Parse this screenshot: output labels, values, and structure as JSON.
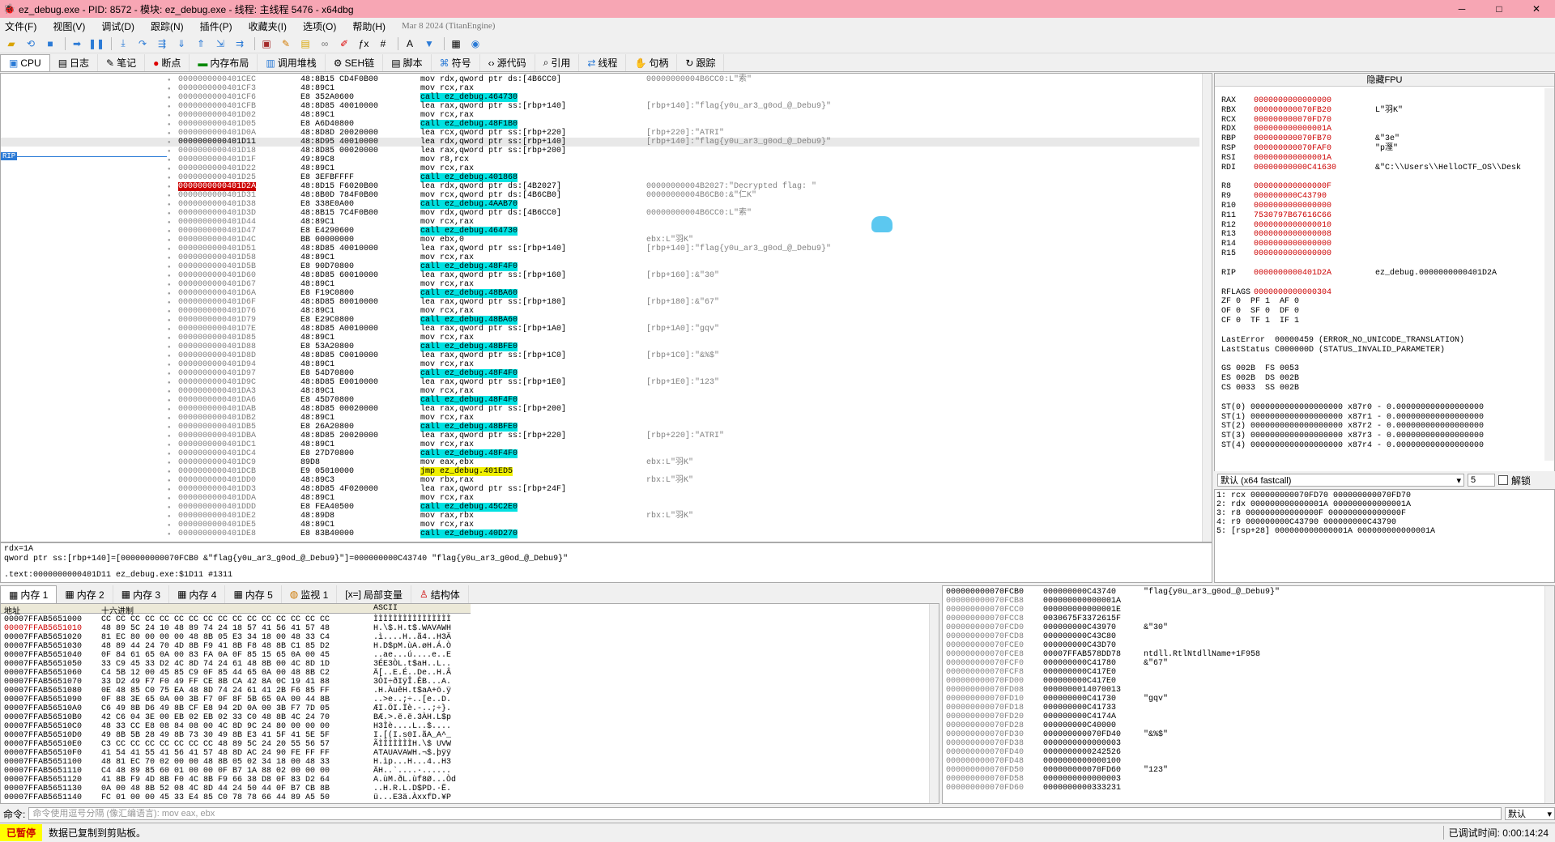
{
  "window": {
    "title": "ez_debug.exe - PID: 8572 - 模块: ez_debug.exe - 线程: 主线程 5476 - x64dbg",
    "minimize": "─",
    "maximize": "□",
    "close": "✕"
  },
  "menu": [
    "文件(F)",
    "视图(V)",
    "调试(D)",
    "跟踪(N)",
    "插件(P)",
    "收藏夹(I)",
    "选项(O)",
    "帮助(H)"
  ],
  "menu_date": "Mar 8 2024 (TitanEngine)",
  "tabs": [
    "CPU",
    "日志",
    "笔记",
    "断点",
    "内存布局",
    "调用堆栈",
    "SEH链",
    "脚本",
    "符号",
    "源代码",
    "引用",
    "线程",
    "句柄",
    "跟踪"
  ],
  "disasm": [
    {
      "addr": "0000000000401CEC",
      "bytes": "48:8B15 CD4F0B00",
      "asm": "mov rdx,qword ptr ds:[4B6CC0]",
      "cmt": "00000000004B6CC0:L\"索\""
    },
    {
      "addr": "0000000000401CF3",
      "bytes": "48:89C1",
      "asm": "mov rcx,rax",
      "cmt": ""
    },
    {
      "addr": "0000000000401CF6",
      "bytes": "E8 352A0600",
      "asm": "call ez_debug.464730",
      "cmt": ""
    },
    {
      "addr": "0000000000401CFB",
      "bytes": "48:8D85 40010000",
      "asm": "lea rax,qword ptr ss:[rbp+140]",
      "cmt": "[rbp+140]:\"flag{y0u_ar3_g0od_@_Debu9}\""
    },
    {
      "addr": "0000000000401D02",
      "bytes": "48:89C1",
      "asm": "mov rcx,rax",
      "cmt": ""
    },
    {
      "addr": "0000000000401D05",
      "bytes": "E8 A6D40800",
      "asm": "call ez_debug.48F1B0",
      "cmt": ""
    },
    {
      "addr": "0000000000401D0A",
      "bytes": "48:8D8D 20020000",
      "asm": "lea rcx,qword ptr ss:[rbp+220]",
      "cmt": "[rbp+220]:\"ATRI\""
    },
    {
      "addr": "0000000000401D11",
      "bytes": "48:8D95 40010000",
      "asm": "lea rdx,qword ptr ss:[rbp+140]",
      "cmt": "[rbp+140]:\"flag{y0u_ar3_g0od_@_Debu9}\""
    },
    {
      "addr": "0000000000401D18",
      "bytes": "48:8D85 00020000",
      "asm": "lea rax,qword ptr ss:[rbp+200]",
      "cmt": ""
    },
    {
      "addr": "0000000000401D1F",
      "bytes": "49:89C8",
      "asm": "mov r8,rcx",
      "cmt": ""
    },
    {
      "addr": "0000000000401D22",
      "bytes": "48:89C1",
      "asm": "mov rcx,rax",
      "cmt": ""
    },
    {
      "addr": "0000000000401D25",
      "bytes": "E8 3EFBFFFF",
      "asm": "call ez_debug.401868",
      "cmt": ""
    },
    {
      "addr": "0000000000401D2A",
      "bytes": "48:8D15 F6020B00",
      "asm": "lea rdx,qword ptr ds:[4B2027]",
      "cmt": "00000000004B2027:\"Decrypted flag: \""
    },
    {
      "addr": "0000000000401D31",
      "bytes": "48:8B0D 784F0B00",
      "asm": "mov rcx,qword ptr ds:[4B6CB0]",
      "cmt": "00000000004B6CB0:&\"仁K\""
    },
    {
      "addr": "0000000000401D38",
      "bytes": "E8 338E0A00",
      "asm": "call ez_debug.4AAB70",
      "cmt": ""
    },
    {
      "addr": "0000000000401D3D",
      "bytes": "48:8B15 7C4F0B00",
      "asm": "mov rdx,qword ptr ds:[4B6CC0]",
      "cmt": "00000000004B6CC0:L\"索\""
    },
    {
      "addr": "0000000000401D44",
      "bytes": "48:89C1",
      "asm": "mov rcx,rax",
      "cmt": ""
    },
    {
      "addr": "0000000000401D47",
      "bytes": "E8 E4290600",
      "asm": "call ez_debug.464730",
      "cmt": ""
    },
    {
      "addr": "0000000000401D4C",
      "bytes": "BB 00000000",
      "asm": "mov ebx,0",
      "cmt": "ebx:L\"羽K\""
    },
    {
      "addr": "0000000000401D51",
      "bytes": "48:8D85 40010000",
      "asm": "lea rax,qword ptr ss:[rbp+140]",
      "cmt": "[rbp+140]:\"flag{y0u_ar3_g0od_@_Debu9}\""
    },
    {
      "addr": "0000000000401D58",
      "bytes": "48:89C1",
      "asm": "mov rcx,rax",
      "cmt": ""
    },
    {
      "addr": "0000000000401D5B",
      "bytes": "E8 90D70800",
      "asm": "call ez_debug.48F4F0",
      "cmt": ""
    },
    {
      "addr": "0000000000401D60",
      "bytes": "48:8D85 60010000",
      "asm": "lea rax,qword ptr ss:[rbp+160]",
      "cmt": "[rbp+160]:&\"30\""
    },
    {
      "addr": "0000000000401D67",
      "bytes": "48:89C1",
      "asm": "mov rcx,rax",
      "cmt": ""
    },
    {
      "addr": "0000000000401D6A",
      "bytes": "E8 F19C0800",
      "asm": "call ez_debug.48BA60",
      "cmt": ""
    },
    {
      "addr": "0000000000401D6F",
      "bytes": "48:8D85 80010000",
      "asm": "lea rax,qword ptr ss:[rbp+180]",
      "cmt": "[rbp+180]:&\"67\""
    },
    {
      "addr": "0000000000401D76",
      "bytes": "48:89C1",
      "asm": "mov rcx,rax",
      "cmt": ""
    },
    {
      "addr": "0000000000401D79",
      "bytes": "E8 E29C0800",
      "asm": "call ez_debug.48BA60",
      "cmt": ""
    },
    {
      "addr": "0000000000401D7E",
      "bytes": "48:8D85 A0010000",
      "asm": "lea rax,qword ptr ss:[rbp+1A0]",
      "cmt": "[rbp+1A0]:\"gqv\""
    },
    {
      "addr": "0000000000401D85",
      "bytes": "48:89C1",
      "asm": "mov rcx,rax",
      "cmt": ""
    },
    {
      "addr": "0000000000401D88",
      "bytes": "E8 53A20800",
      "asm": "call ez_debug.48BFE0",
      "cmt": ""
    },
    {
      "addr": "0000000000401D8D",
      "bytes": "48:8D85 C0010000",
      "asm": "lea rax,qword ptr ss:[rbp+1C0]",
      "cmt": "[rbp+1C0]:\"&%$\""
    },
    {
      "addr": "0000000000401D94",
      "bytes": "48:89C1",
      "asm": "mov rcx,rax",
      "cmt": ""
    },
    {
      "addr": "0000000000401D97",
      "bytes": "E8 54D70800",
      "asm": "call ez_debug.48F4F0",
      "cmt": ""
    },
    {
      "addr": "0000000000401D9C",
      "bytes": "48:8D85 E0010000",
      "asm": "lea rax,qword ptr ss:[rbp+1E0]",
      "cmt": "[rbp+1E0]:\"123\""
    },
    {
      "addr": "0000000000401DA3",
      "bytes": "48:89C1",
      "asm": "mov rcx,rax",
      "cmt": ""
    },
    {
      "addr": "0000000000401DA6",
      "bytes": "E8 45D70800",
      "asm": "call ez_debug.48F4F0",
      "cmt": ""
    },
    {
      "addr": "0000000000401DAB",
      "bytes": "48:8D85 00020000",
      "asm": "lea rax,qword ptr ss:[rbp+200]",
      "cmt": ""
    },
    {
      "addr": "0000000000401DB2",
      "bytes": "48:89C1",
      "asm": "mov rcx,rax",
      "cmt": ""
    },
    {
      "addr": "0000000000401DB5",
      "bytes": "E8 26A20800",
      "asm": "call ez_debug.48BFE0",
      "cmt": ""
    },
    {
      "addr": "0000000000401DBA",
      "bytes": "48:8D85 20020000",
      "asm": "lea rax,qword ptr ss:[rbp+220]",
      "cmt": "[rbp+220]:\"ATRI\""
    },
    {
      "addr": "0000000000401DC1",
      "bytes": "48:89C1",
      "asm": "mov rcx,rax",
      "cmt": ""
    },
    {
      "addr": "0000000000401DC4",
      "bytes": "E8 27D70800",
      "asm": "call ez_debug.48F4F0",
      "cmt": ""
    },
    {
      "addr": "0000000000401DC9",
      "bytes": "89D8",
      "asm": "mov eax,ebx",
      "cmt": "ebx:L\"羽K\""
    },
    {
      "addr": "0000000000401DCB",
      "bytes": "E9 05010000",
      "asm": "jmp ez_debug.401ED5",
      "cmt": ""
    },
    {
      "addr": "0000000000401DD0",
      "bytes": "48:89C3",
      "asm": "mov rbx,rax",
      "cmt": "rbx:L\"羽K\""
    },
    {
      "addr": "0000000000401DD3",
      "bytes": "48:8D85 4F020000",
      "asm": "lea rax,qword ptr ss:[rbp+24F]",
      "cmt": ""
    },
    {
      "addr": "0000000000401DDA",
      "bytes": "48:89C1",
      "asm": "mov rcx,rax",
      "cmt": ""
    },
    {
      "addr": "0000000000401DDD",
      "bytes": "E8 FEA40500",
      "asm": "call ez_debug.45C2E0",
      "cmt": ""
    },
    {
      "addr": "0000000000401DE2",
      "bytes": "48:89D8",
      "asm": "mov rax,rbx",
      "cmt": "rbx:L\"羽K\""
    },
    {
      "addr": "0000000000401DE5",
      "bytes": "48:89C1",
      "asm": "mov rcx,rax",
      "cmt": ""
    },
    {
      "addr": "0000000000401DE8",
      "bytes": "E8 83B40000",
      "asm": "call ez_debug.40D270",
      "cmt": ""
    }
  ],
  "rip_label": "RIP",
  "info": {
    "line1": "rdx=1A",
    "line2": "qword ptr ss:[rbp+140]=[000000000070FCB0 &\"flag{y0u_ar3_g0od_@_Debu9}\"]=000000000C43740 \"flag{y0u_ar3_g0od_@_Debu9}\"",
    "line3": ".text:0000000000401D11 ez_debug.exe:$1D11 #1311"
  },
  "reg_header": "隐藏FPU",
  "regs": [
    {
      "n": "RAX",
      "v": "0000000000000000",
      "c": ""
    },
    {
      "n": "RBX",
      "v": "000000000070FB20",
      "c": "L\"羽K\""
    },
    {
      "n": "RCX",
      "v": "000000000070FD70",
      "c": ""
    },
    {
      "n": "RDX",
      "v": "000000000000001A",
      "c": ""
    },
    {
      "n": "RBP",
      "v": "000000000070FB70",
      "c": "&\"3e\""
    },
    {
      "n": "RSP",
      "v": "000000000070FAF0",
      "c": "\"p溼\""
    },
    {
      "n": "RSI",
      "v": "000000000000001A",
      "c": ""
    },
    {
      "n": "RDI",
      "v": "00000000000C41630",
      "c": "&\"C:\\\\Users\\\\HelloCTF_OS\\\\Desk"
    }
  ],
  "regs2": [
    {
      "n": "R8",
      "v": "000000000000000F"
    },
    {
      "n": "R9",
      "v": "000000000C43790"
    },
    {
      "n": "R10",
      "v": "0000000000000000"
    },
    {
      "n": "R11",
      "v": "7530797B67616C66"
    },
    {
      "n": "R12",
      "v": "0000000000000010"
    },
    {
      "n": "R13",
      "v": "0000000000000008"
    },
    {
      "n": "R14",
      "v": "0000000000000000"
    },
    {
      "n": "R15",
      "v": "0000000000000000"
    }
  ],
  "rip_reg": {
    "n": "RIP",
    "v": "0000000000401D2A",
    "c": "ez_debug.0000000000401D2A"
  },
  "rflags": {
    "n": "RFLAGS",
    "v": "0000000000000304"
  },
  "flags": [
    "ZF 0  PF 1  AF 0",
    "OF 0  SF 0  DF 0",
    "CF 0  TF 1  IF 1"
  ],
  "lasterror": "LastError  00000459 (ERROR_NO_UNICODE_TRANSLATION)",
  "laststatus": "LastStatus C000000D (STATUS_INVALID_PARAMETER)",
  "segs": [
    "GS 002B  FS 0053",
    "ES 002B  DS 002B",
    "CS 0033  SS 002B"
  ],
  "fpu": [
    "ST(0) 0000000000000000000 x87r0 ‐ 0.000000000000000000",
    "ST(1) 0000000000000000000 x87r1 ‐ 0.000000000000000000",
    "ST(2) 0000000000000000000 x87r2 ‐ 0.000000000000000000",
    "ST(3) 0000000000000000000 x87r3 ‐ 0.000000000000000000",
    "ST(4) 0000000000000000000 x87r4 ‐ 0.000000000000000000"
  ],
  "callconv": {
    "label": "默认 (x64 fastcall)",
    "count": "5",
    "unlock": "解锁"
  },
  "args": [
    "1: rcx 000000000070FD70 000000000070FD70",
    "2: rdx 000000000000001A 000000000000001A",
    "3: r8 000000000000000F 000000000000000F",
    "4: r9 000000000C43790 000000000C43790",
    "5: [rsp+28] 000000000000001A 000000000000001A"
  ],
  "dumptabs": [
    "内存 1",
    "内存 2",
    "内存 3",
    "内存 4",
    "内存 5",
    "监视 1",
    "局部变量",
    "结构体"
  ],
  "dump_headers": {
    "addr": "地址",
    "hex": "十六进制",
    "ascii": "ASCII"
  },
  "dump": [
    {
      "a": "00007FFAB5651000",
      "h": "CC CC CC CC CC CC CC CC CC CC CC CC CC CC CC CC",
      "s": "ÌÌÌÌÌÌÌÌÌÌÌÌÌÌÌÌ"
    },
    {
      "a": "00007FFAB5651010",
      "h": "48 89 5C 24 10 48 89 74 24 18 57 41 56 41 57 48",
      "s": "H.\\$.H.t$.WAVAWH"
    },
    {
      "a": "00007FFAB5651020",
      "h": "81 EC 80 00 00 00 48 8B 05 E3 34 18 00 48 33 C4",
      "s": ".ì....H..ã4..H3Ä"
    },
    {
      "a": "00007FFAB5651030",
      "h": "48 89 44 24 70 4D 8B F9 41 8B F8 48 8B C1 85 D2",
      "s": "H.D$pM.ùA.øH.Á.Ò"
    },
    {
      "a": "00007FFAB5651040",
      "h": "0F 84 61 65 0A 00 83 FA 0A 0F 85 15 65 0A 00 45",
      "s": "..ae...ú....e..E"
    },
    {
      "a": "00007FFAB5651050",
      "h": "33 C9 45 33 D2 4C 8D 74 24 61 48 8B 00 4C 8D 1D",
      "s": "3ÉE3ÒL.t$aH..L.."
    },
    {
      "a": "00007FFAB5651060",
      "h": "C4 5B 12 00 45 85 C9 0F 85 44 65 0A 00 48 8B C2",
      "s": "Ä[..E.É..De..H.Â"
    },
    {
      "a": "00007FFAB5651070",
      "h": "33 D2 49 F7 F0 49 FF CE 8B CA 42 8A 0C 19 41 88",
      "s": "3ÒI÷ðIÿÎ.ÊB...A."
    },
    {
      "a": "00007FFAB5651080",
      "h": "0E 48 85 C0 75 EA 48 8D 74 24 61 41 2B F6 85 FF",
      "s": ".H.ÀuêH.t$aA+ö.ÿ"
    },
    {
      "a": "00007FFAB5651090",
      "h": "0F 88 3E 65 0A 00 3B F7 0F 8F 5B 65 0A 00 44 8B",
      "s": "..>e..;÷..[e..D."
    },
    {
      "a": "00007FFAB56510A0",
      "h": "C6 49 8B D6 49 8B CF E8 94 2D 0A 00 3B F7 7D 05",
      "s": "ÆI.ÖI.Ïè.-..;÷}."
    },
    {
      "a": "00007FFAB56510B0",
      "h": "42 C6 04 3E 00 EB 02 EB 02 33 C0 48 8B 4C 24 70",
      "s": "BÆ.>.ë.ë.3ÀH.L$p"
    },
    {
      "a": "00007FFAB56510C0",
      "h": "48 33 CC E8 08 84 08 00 4C 8D 9C 24 80 00 00 00",
      "s": "H3Ìè....L..$...."
    },
    {
      "a": "00007FFAB56510D0",
      "h": "49 8B 5B 28 49 8B 73 30 49 8B E3 41 5F 41 5E 5F",
      "s": "I.[(I.s0I.ãA_A^_"
    },
    {
      "a": "00007FFAB56510E0",
      "h": "C3 CC CC CC CC CC CC CC 48 89 5C 24 20 55 56 57",
      "s": "ÃÌÌÌÌÌÌÌH.\\$ UVW"
    },
    {
      "a": "00007FFAB56510F0",
      "h": "41 54 41 55 41 56 41 57 48 8D AC 24 90 FE FF FF",
      "s": "ATAUAVAWH.¬$.þÿÿ"
    },
    {
      "a": "00007FFAB5651100",
      "h": "48 81 EC 70 02 00 00 48 8B 05 02 34 18 00 48 33",
      "s": "H.ìp...H...4..H3"
    },
    {
      "a": "00007FFAB5651110",
      "h": "C4 48 89 85 60 01 00 00 0F B7 1A 88 02 00 00 00",
      "s": "ÄH..`....·......"
    },
    {
      "a": "00007FFAB5651120",
      "h": "41 8B F9 4D 8B F0 4C 8B F9 66 38 D8 0F 83 D2 64",
      "s": "A.ùM.ðL.ùf8Ø...Òd"
    },
    {
      "a": "00007FFAB5651130",
      "h": "0A 00 48 8B 52 08 4C 8D 44 24 50 44 0F B7 CB 8B",
      "s": "..H.R.L.D$PD.·Ë."
    },
    {
      "a": "00007FFAB5651140",
      "h": "FC 01 00 00 45 33 E4 85 C0 78 78 66 44 89 A5 50",
      "s": "ü...E3ä.ÀxxfD.¥P"
    }
  ],
  "stack": [
    {
      "a": "000000000070FCB0",
      "v": "000000000C43740",
      "c": "\"flag{y0u_ar3_g0od_@_Debu9}\""
    },
    {
      "a": "000000000070FCB8",
      "v": "000000000000001A",
      "c": ""
    },
    {
      "a": "000000000070FCC0",
      "v": "000000000000001E",
      "c": ""
    },
    {
      "a": "000000000070FCC8",
      "v": "0030675F3372615F",
      "c": ""
    },
    {
      "a": "000000000070FCD0",
      "v": "000000000C43970",
      "c": "&\"30\""
    },
    {
      "a": "000000000070FCD8",
      "v": "000000000C43C80",
      "c": ""
    },
    {
      "a": "000000000070FCE0",
      "v": "000000000C43D70",
      "c": ""
    },
    {
      "a": "000000000070FCE8",
      "v": "00007FFAB578DD78",
      "c": "ntdll.RtlNtdllName+1F958"
    },
    {
      "a": "000000000070FCF0",
      "v": "000000000C41780",
      "c": "&\"67\""
    },
    {
      "a": "000000000070FCF8",
      "v": "000000000C417E0",
      "c": ""
    },
    {
      "a": "000000000070FD00",
      "v": "000000000C417E0",
      "c": ""
    },
    {
      "a": "000000000070FD08",
      "v": "0000000014070013",
      "c": ""
    },
    {
      "a": "000000000070FD10",
      "v": "000000000C41730",
      "c": "\"gqv\""
    },
    {
      "a": "000000000070FD18",
      "v": "000000000C41733",
      "c": ""
    },
    {
      "a": "000000000070FD20",
      "v": "000000000C4174A",
      "c": ""
    },
    {
      "a": "000000000070FD28",
      "v": "000000000C40000",
      "c": ""
    },
    {
      "a": "000000000070FD30",
      "v": "000000000070FD40",
      "c": "\"&%$\""
    },
    {
      "a": "000000000070FD38",
      "v": "0000000000000003",
      "c": ""
    },
    {
      "a": "000000000070FD40",
      "v": "0000000000242526",
      "c": ""
    },
    {
      "a": "000000000070FD48",
      "v": "0000000000000100",
      "c": ""
    },
    {
      "a": "000000000070FD50",
      "v": "000000000070FD60",
      "c": "\"123\""
    },
    {
      "a": "000000000070FD58",
      "v": "0000000000000003",
      "c": ""
    },
    {
      "a": "000000000070FD60",
      "v": "0000000000333231",
      "c": ""
    }
  ],
  "cmd": {
    "label": "命令:",
    "placeholder": "命令使用逗号分隔 (像汇编语言): mov eax, ebx",
    "default": "默认"
  },
  "status": {
    "paused": "已暂停",
    "msg": "数据已复制到剪贴板。",
    "time": "已调试时间:  0:00:14:24"
  }
}
